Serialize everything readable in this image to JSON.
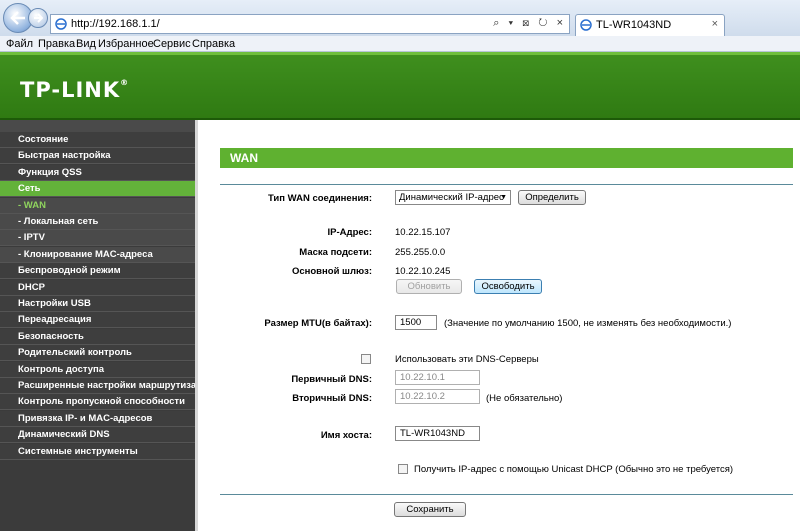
{
  "browser": {
    "url": "http://192.168.1.1/",
    "url_tools": "⌕ ▾ ⊠ ↻ ×",
    "tab_title": "TL-WR1043ND",
    "tab_close": "×",
    "menu": [
      "Файл",
      "Правка",
      "Вид",
      "Избранное",
      "Сервис",
      "Справка"
    ]
  },
  "header": {
    "logo": "TP-LINK",
    "logo_mark": "®"
  },
  "sidebar": {
    "items": [
      {
        "label": "Состояние",
        "state": "normal"
      },
      {
        "label": "Быстрая настройка",
        "state": "normal"
      },
      {
        "label": "Функция QSS",
        "state": "normal"
      },
      {
        "label": "Сеть",
        "state": "active"
      },
      {
        "label": "- WAN",
        "state": "sub-active"
      },
      {
        "label": "- Локальная сеть",
        "state": "sub"
      },
      {
        "label": "- IPTV",
        "state": "sub"
      },
      {
        "label": "- Клонирование MAC-адреса",
        "state": "sub"
      },
      {
        "label": "Беспроводной режим",
        "state": "normal"
      },
      {
        "label": "DHCP",
        "state": "normal"
      },
      {
        "label": "Настройки USB",
        "state": "normal"
      },
      {
        "label": "Переадресация",
        "state": "normal"
      },
      {
        "label": "Безопасность",
        "state": "normal"
      },
      {
        "label": "Родительский контроль",
        "state": "normal"
      },
      {
        "label": "Контроль доступа",
        "state": "normal"
      },
      {
        "label": "Расширенные настройки маршрутизации",
        "state": "normal"
      },
      {
        "label": "Контроль пропускной способности",
        "state": "normal"
      },
      {
        "label": "Привязка IP- и MAC-адресов",
        "state": "normal"
      },
      {
        "label": "Динамический DNS",
        "state": "normal"
      },
      {
        "label": "Системные инструменты",
        "state": "normal"
      }
    ]
  },
  "wan": {
    "title": "WAN",
    "conn_type_label": "Тип WAN соединения:",
    "conn_type_value": "Динамический IP-адрес",
    "detect_button": "Определить",
    "ip_label": "IP-Адрес:",
    "ip_value": "10.22.15.107",
    "mask_label": "Маска подсети:",
    "mask_value": "255.255.0.0",
    "gateway_label": "Основной шлюз:",
    "gateway_value": "10.22.10.245",
    "renew_button": "Обновить",
    "release_button": "Освободить",
    "mtu_label": "Размер MTU(в байтах):",
    "mtu_value": "1500",
    "mtu_hint": "(Значение по умолчанию 1500, не изменять без необходимости.)",
    "use_dns_label": "Использовать эти DNS-Серверы",
    "use_dns_checked": false,
    "primary_dns_label": "Первичный DNS:",
    "primary_dns_value": "10.22.10.1",
    "secondary_dns_label": "Вторичный DNS:",
    "secondary_dns_value": "10.22.10.2",
    "secondary_dns_hint": "(Не обязательно)",
    "hostname_label": "Имя хоста:",
    "hostname_value": "TL-WR1043ND",
    "unicast_label": "Получить IP-адрес с помощью Unicast DHCP (Обычно это не требуется)",
    "unicast_checked": false,
    "save_button": "Сохранить"
  },
  "colors": {
    "accent": "#5fb130",
    "header": "#2f7a12",
    "sidebar": "#3e3e3e"
  }
}
